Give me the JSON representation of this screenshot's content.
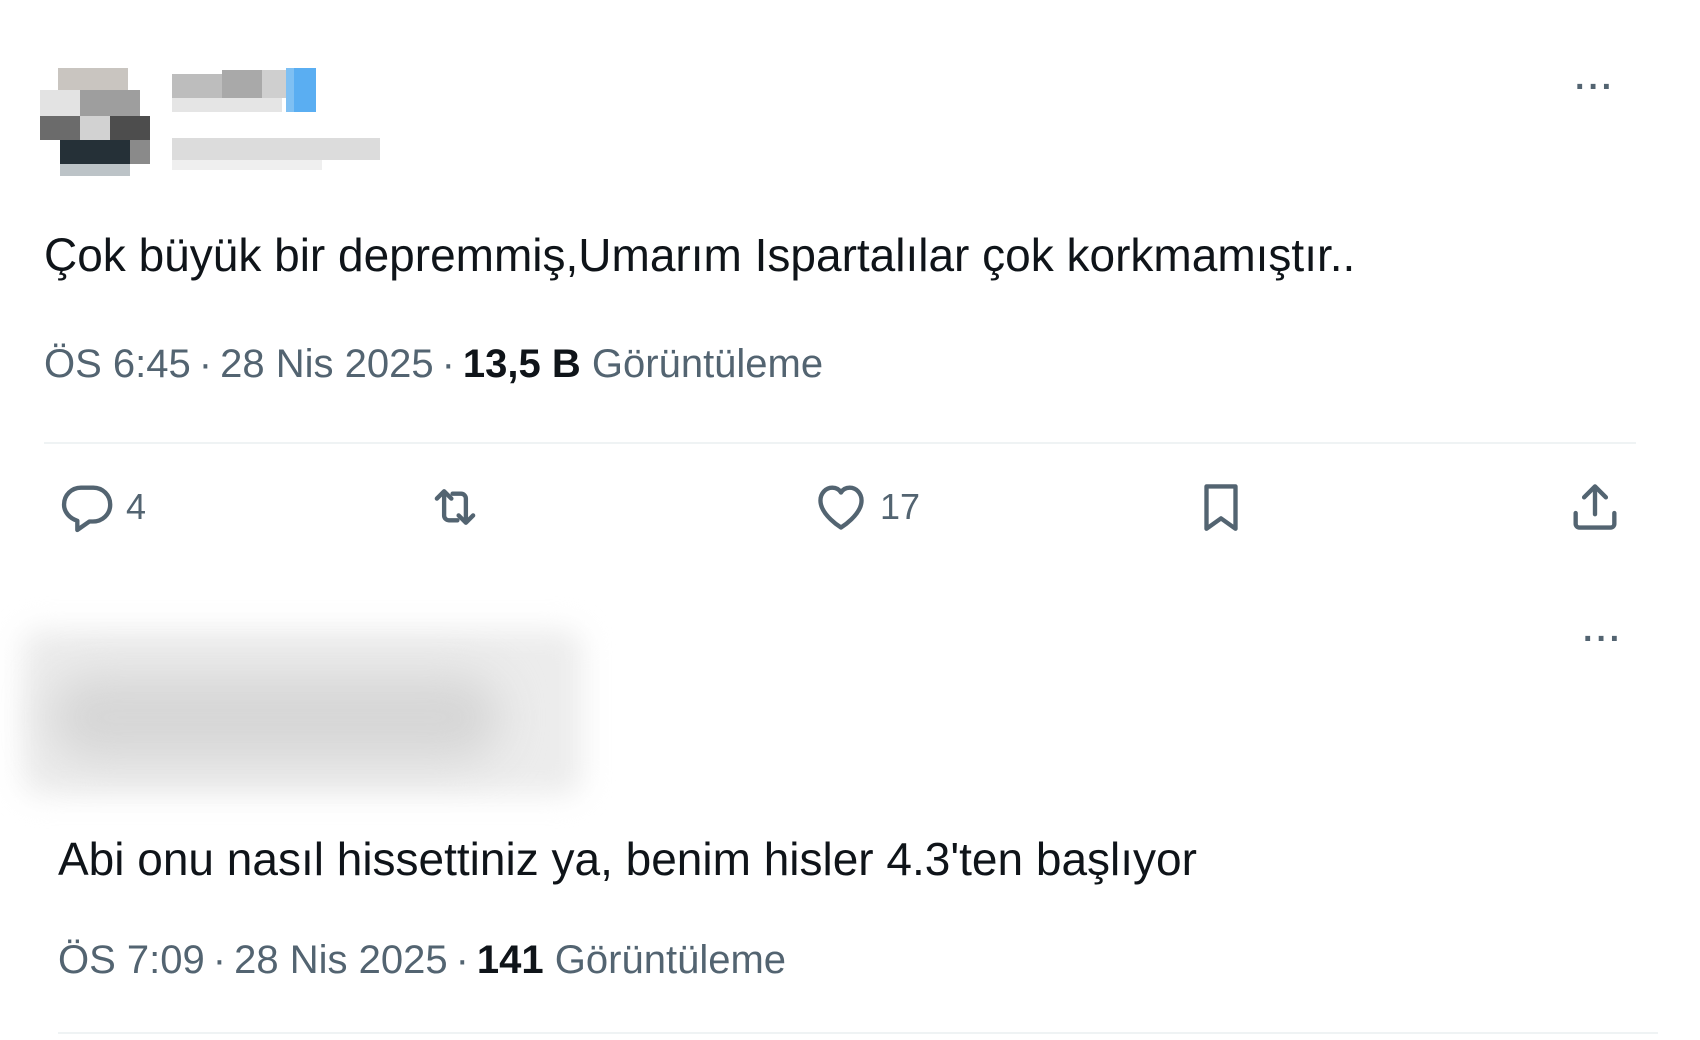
{
  "tweets": [
    {
      "text": "Çok büyük bir depremmiş,Umarım Ispartalılar çok korkmamıştır..",
      "time": "ÖS 6:45",
      "date": "28 Nis 2025",
      "views_count": "13,5 B",
      "views_label": "Görüntüleme",
      "more_label": "···",
      "actions": {
        "reply_count": "4",
        "like_count": "17"
      }
    },
    {
      "text": "Abi onu nasıl hissettiniz ya, benim hisler 4.3'ten başlıyor",
      "time": "ÖS 7:09",
      "date": "28 Nis 2025",
      "views_count": "141",
      "views_label": "Görüntüleme",
      "more_label": "···"
    }
  ],
  "separator": "·",
  "icons": {
    "reply": "reply-icon",
    "retweet": "retweet-icon",
    "like": "heart-icon",
    "bookmark": "bookmark-icon",
    "share": "share-icon",
    "more": "more-icon"
  },
  "colors": {
    "text": "#0f1419",
    "muted": "#536471",
    "divider": "#eff3f4",
    "avatar_accent": "#5aaef2"
  }
}
